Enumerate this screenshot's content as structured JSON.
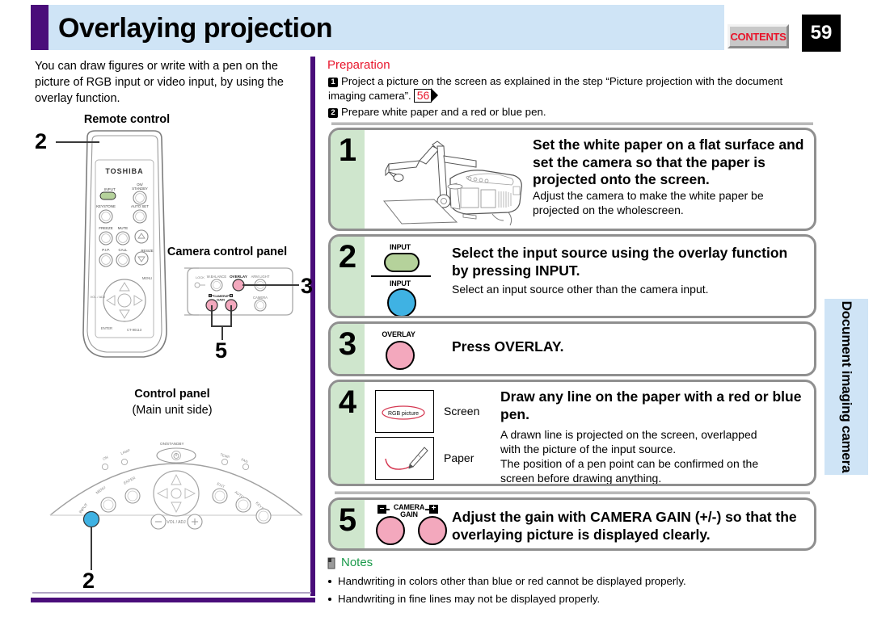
{
  "header": {
    "title": "Overlaying projection",
    "contents_label": "CONTENTS",
    "page_number": "59",
    "accent_purple": "#4a0d7a",
    "accent_blue": "#cfe4f6",
    "contents_red": "#e8152b"
  },
  "side_tab": {
    "label": "Document imaging camera"
  },
  "left": {
    "intro": "You can draw figures or write with a pen on the picture of RGB input or video input, by using the overlay function.",
    "figures": [
      {
        "caption": "Remote control",
        "brand": "TOSHIBA",
        "callout": "2"
      },
      {
        "caption": "Camera control panel",
        "callouts": [
          "3",
          "5"
        ]
      },
      {
        "caption": "Control panel",
        "subcaption": "(Main unit side)",
        "callout": "2"
      }
    ],
    "remote_buttons": [
      "INPUT",
      "ON/ STANDBY",
      "KEYSTONE",
      "AUTO SET",
      "FREEZE",
      "MUTE",
      "P.I.P.",
      "CALL",
      "RESIZE",
      "MENU"
    ],
    "camera_panel_buttons": [
      "LOCK",
      "W.BALANCE",
      "OVERLAY",
      "ARM LIGHT",
      "CAMERA",
      "CAMERA GAIN"
    ],
    "control_panel_buttons": [
      "ON/STANDBY",
      "ON",
      "LAMP",
      "TEMP",
      "FAN",
      "INPUT",
      "MENU",
      "ENTER",
      "EXIT",
      "AUTO SET",
      "KEYSTONE",
      "VOL / ADJ"
    ]
  },
  "preparation": {
    "title": "Preparation",
    "items": [
      {
        "num": "1",
        "text_before": "Project a picture on the screen as explained in the step “Picture projection with the document imaging camera”.",
        "page_ref": "56"
      },
      {
        "num": "2",
        "text_before": "Prepare white paper and a red or blue pen."
      }
    ]
  },
  "steps": [
    {
      "num": "1",
      "heading": "Set the white paper on a flat surface and set the camera so that the paper is projected onto the screen.",
      "body": "Adjust the camera to make the white paper be projected on the wholescreen.",
      "illustration": "projector-document-camera"
    },
    {
      "num": "2",
      "heading": "Select the input source using the overlay function by pressing INPUT.",
      "body": "Select an input source other than the camera input.",
      "buttons": [
        {
          "label": "INPUT",
          "shape": "rounded-rect",
          "color": "#b5d29b"
        },
        {
          "label": "INPUT",
          "shape": "circle",
          "color": "#3fb2e3"
        }
      ]
    },
    {
      "num": "3",
      "heading": "Press OVERLAY.",
      "body": "",
      "buttons": [
        {
          "label": "OVERLAY",
          "shape": "circle",
          "color": "#f3a8bd"
        }
      ]
    },
    {
      "num": "4",
      "heading": "Draw any line on the paper with a red or blue pen.",
      "body_lines": [
        "A drawn line is projected on the screen, overlapped",
        "with the picture of the input source.",
        "The position of a pen point can be confirmed on the",
        "screen before drawing anything."
      ],
      "thumbs": [
        {
          "label": "Screen",
          "content": "RGB picture"
        },
        {
          "label": "Paper",
          "content": "pen-drawing"
        }
      ]
    },
    {
      "num": "5",
      "heading": "Adjust the gain with CAMERA GAIN (+/-) so that the overlaying picture is displayed clearly.",
      "body": "",
      "button_group_label": "CAMERA GAIN",
      "buttons": [
        {
          "label": "-",
          "shape": "circle",
          "color": "#f3a8bd"
        },
        {
          "label": "+",
          "shape": "circle",
          "color": "#f3a8bd"
        }
      ]
    }
  ],
  "notes": {
    "title": "Notes",
    "title_color": "#1b9a4b",
    "items": [
      "Handwriting in colors other than blue or red cannot be displayed properly.",
      "Handwriting in fine lines may not be displayed properly."
    ]
  }
}
